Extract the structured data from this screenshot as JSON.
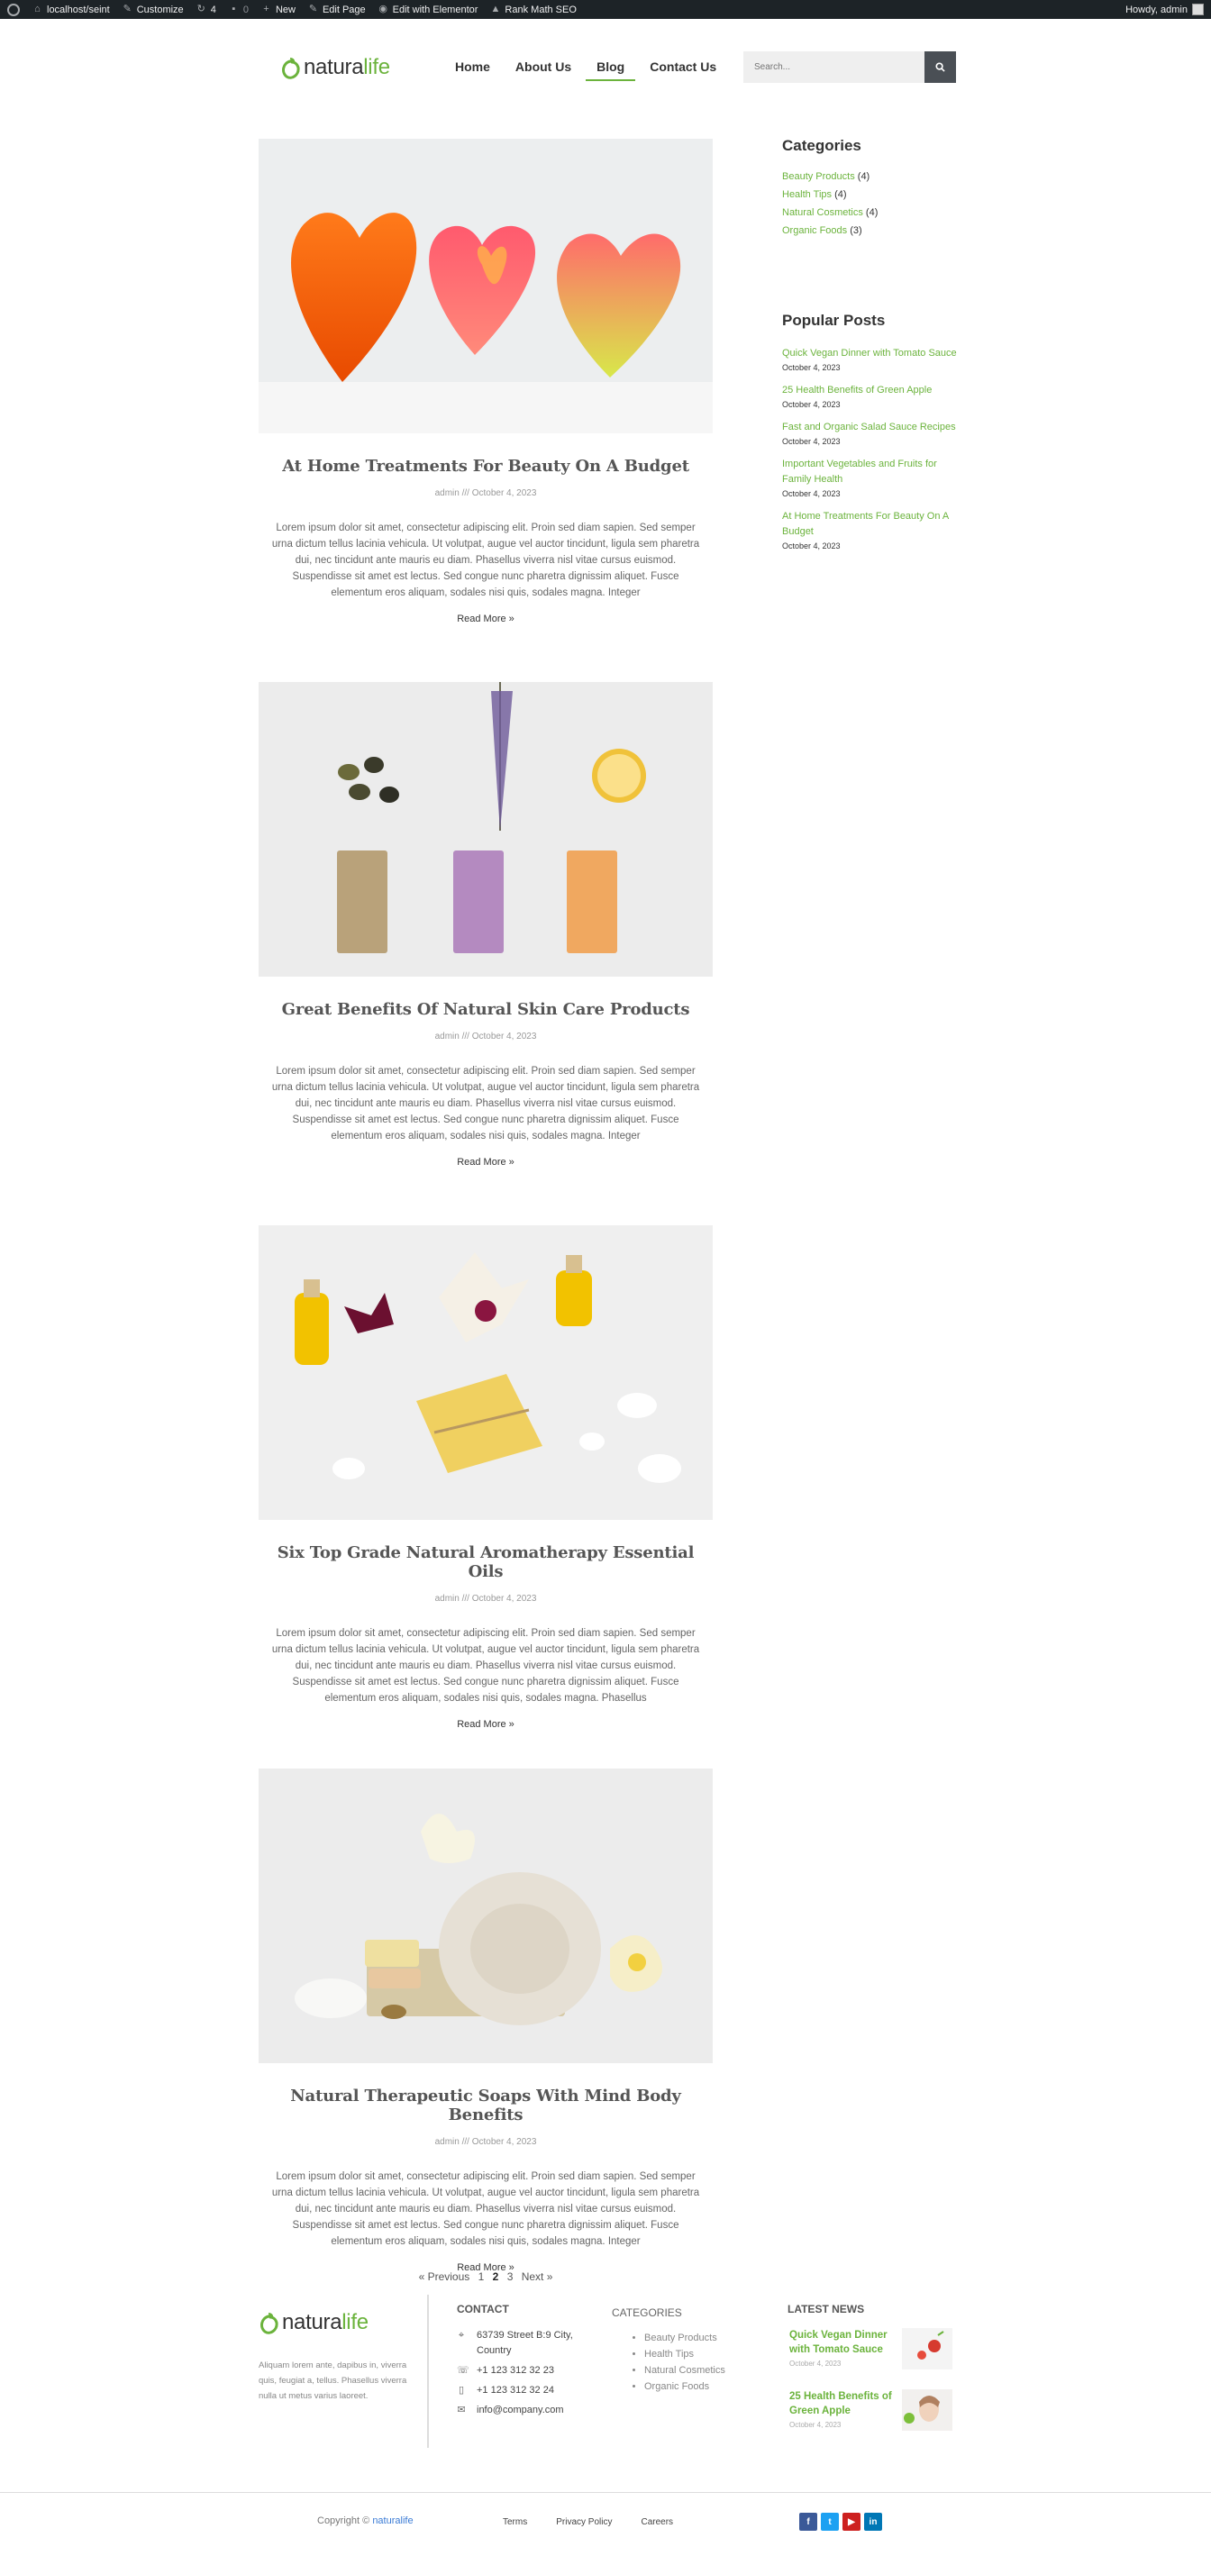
{
  "admin_bar": {
    "site": "localhost/seint",
    "customize": "Customize",
    "updates": "4",
    "comments": "0",
    "new": "New",
    "edit_page": "Edit Page",
    "elementor": "Edit with Elementor",
    "rank_math": "Rank Math SEO",
    "howdy": "Howdy, admin"
  },
  "header": {
    "logo_natura": "natura",
    "logo_life": "life",
    "nav": [
      "Home",
      "About Us",
      "Blog",
      "Contact Us"
    ],
    "active_nav": "Blog",
    "search_placeholder": "Search..."
  },
  "posts": [
    {
      "title": "At Home Treatments For Beauty On A Budget",
      "meta": "admin /// October 4, 2023",
      "excerpt": "Lorem ipsum dolor sit amet, consectetur adipiscing elit. Proin sed diam sapien. Sed semper urna dictum tellus lacinia vehicula. Ut volutpat, augue vel auctor tincidunt, ligula sem pharetra dui, nec tincidunt ante mauris eu diam. Phasellus viverra nisl vitae cursus euismod. Suspendisse sit amet est lectus. Sed congue nunc pharetra dignissim aliquet. Fusce elementum eros aliquam, sodales nisi quis, sodales magna. Integer",
      "read_more": "Read More »"
    },
    {
      "title": "Great Benefits Of Natural Skin Care Products",
      "meta": "admin /// October 4, 2023",
      "excerpt": "Lorem ipsum dolor sit amet, consectetur adipiscing elit. Proin sed diam sapien. Sed semper urna dictum tellus lacinia vehicula. Ut volutpat, augue vel auctor tincidunt, ligula sem pharetra dui, nec tincidunt ante mauris eu diam. Phasellus viverra nisl vitae cursus euismod. Suspendisse sit amet est lectus. Sed congue nunc pharetra dignissim aliquet. Fusce elementum eros aliquam, sodales nisi quis, sodales magna. Integer",
      "read_more": "Read More »"
    },
    {
      "title": "Six Top Grade Natural Aromatherapy Essential Oils",
      "meta": "admin /// October 4, 2023",
      "excerpt": "Lorem ipsum dolor sit amet, consectetur adipiscing elit. Proin sed diam sapien. Sed semper urna dictum tellus lacinia vehicula. Ut volutpat, augue vel auctor tincidunt, ligula sem pharetra dui, nec tincidunt ante mauris eu diam. Phasellus viverra nisl vitae cursus euismod. Suspendisse sit amet est lectus. Sed congue nunc pharetra dignissim aliquet. Fusce elementum eros aliquam, sodales nisi quis, sodales magna. Phasellus",
      "read_more": "Read More »"
    },
    {
      "title": "Natural Therapeutic Soaps With Mind Body Benefits",
      "meta": "admin /// October 4, 2023",
      "excerpt": "Lorem ipsum dolor sit amet, consectetur adipiscing elit. Proin sed diam sapien. Sed semper urna dictum tellus lacinia vehicula. Ut volutpat, augue vel auctor tincidunt, ligula sem pharetra dui, nec tincidunt ante mauris eu diam. Phasellus viverra nisl vitae cursus euismod. Suspendisse sit amet est lectus. Sed congue nunc pharetra dignissim aliquet. Fusce elementum eros aliquam, sodales nisi quis, sodales magna. Integer",
      "read_more": "Read More »"
    }
  ],
  "pagination": {
    "prev": "« Previous",
    "pages": [
      "1",
      "2",
      "3"
    ],
    "current": "2",
    "next": "Next »"
  },
  "sidebar": {
    "categories_title": "Categories",
    "categories": [
      {
        "name": "Beauty Products",
        "count": "(4)"
      },
      {
        "name": "Health Tips",
        "count": "(4)"
      },
      {
        "name": "Natural Cosmetics",
        "count": "(4)"
      },
      {
        "name": "Organic Foods",
        "count": "(3)"
      }
    ],
    "popular_title": "Popular Posts",
    "popular": [
      {
        "title": "Quick Vegan Dinner with Tomato Sauce",
        "date": "October 4, 2023"
      },
      {
        "title": "25 Health Benefits of Green Apple",
        "date": "October 4, 2023"
      },
      {
        "title": "Fast and Organic Salad Sauce Recipes",
        "date": "October 4, 2023"
      },
      {
        "title": "Important Vegetables and Fruits for Family Health",
        "date": "October 4, 2023"
      },
      {
        "title": "At Home Treatments For Beauty On A Budget",
        "date": "October 4, 2023"
      }
    ]
  },
  "footer": {
    "about": "Aliquam lorem ante, dapibus in, viverra quis, feugiat a, tellus. Phasellus viverra nulla ut metus varius laoreet.",
    "contact_heading": "CONTACT",
    "address": "63739 Street B:9 City, Country",
    "phone": "+1 123 312 32 23",
    "mobile": "+1 123 312 32 24",
    "email": "info@company.com",
    "categories_heading": "CATEGORIES",
    "categories": [
      "Beauty Products",
      "Health Tips",
      "Natural Cosmetics",
      "Organic Foods"
    ],
    "news_heading": "LATEST NEWS",
    "news": [
      {
        "title": "Quick Vegan Dinner with Tomato Sauce",
        "date": "October 4, 2023"
      },
      {
        "title": "25 Health Benefits of Green Apple",
        "date": "October 4, 2023"
      }
    ],
    "copyright_prefix": "Copyright ©",
    "copyright_brand": "naturalife",
    "links": [
      "Terms",
      "Privacy Policy",
      "Careers"
    ],
    "social": [
      {
        "icon": "facebook-icon",
        "glyph": "f",
        "color": "#3b5998"
      },
      {
        "icon": "twitter-icon",
        "glyph": "t",
        "color": "#1da1f2"
      },
      {
        "icon": "youtube-icon",
        "glyph": "▶",
        "color": "#cd201f"
      },
      {
        "icon": "linkedin-icon",
        "glyph": "in",
        "color": "#0077b5"
      }
    ]
  },
  "colors": {
    "accent": "#6bb33c",
    "adminbar": "#1d2327"
  }
}
